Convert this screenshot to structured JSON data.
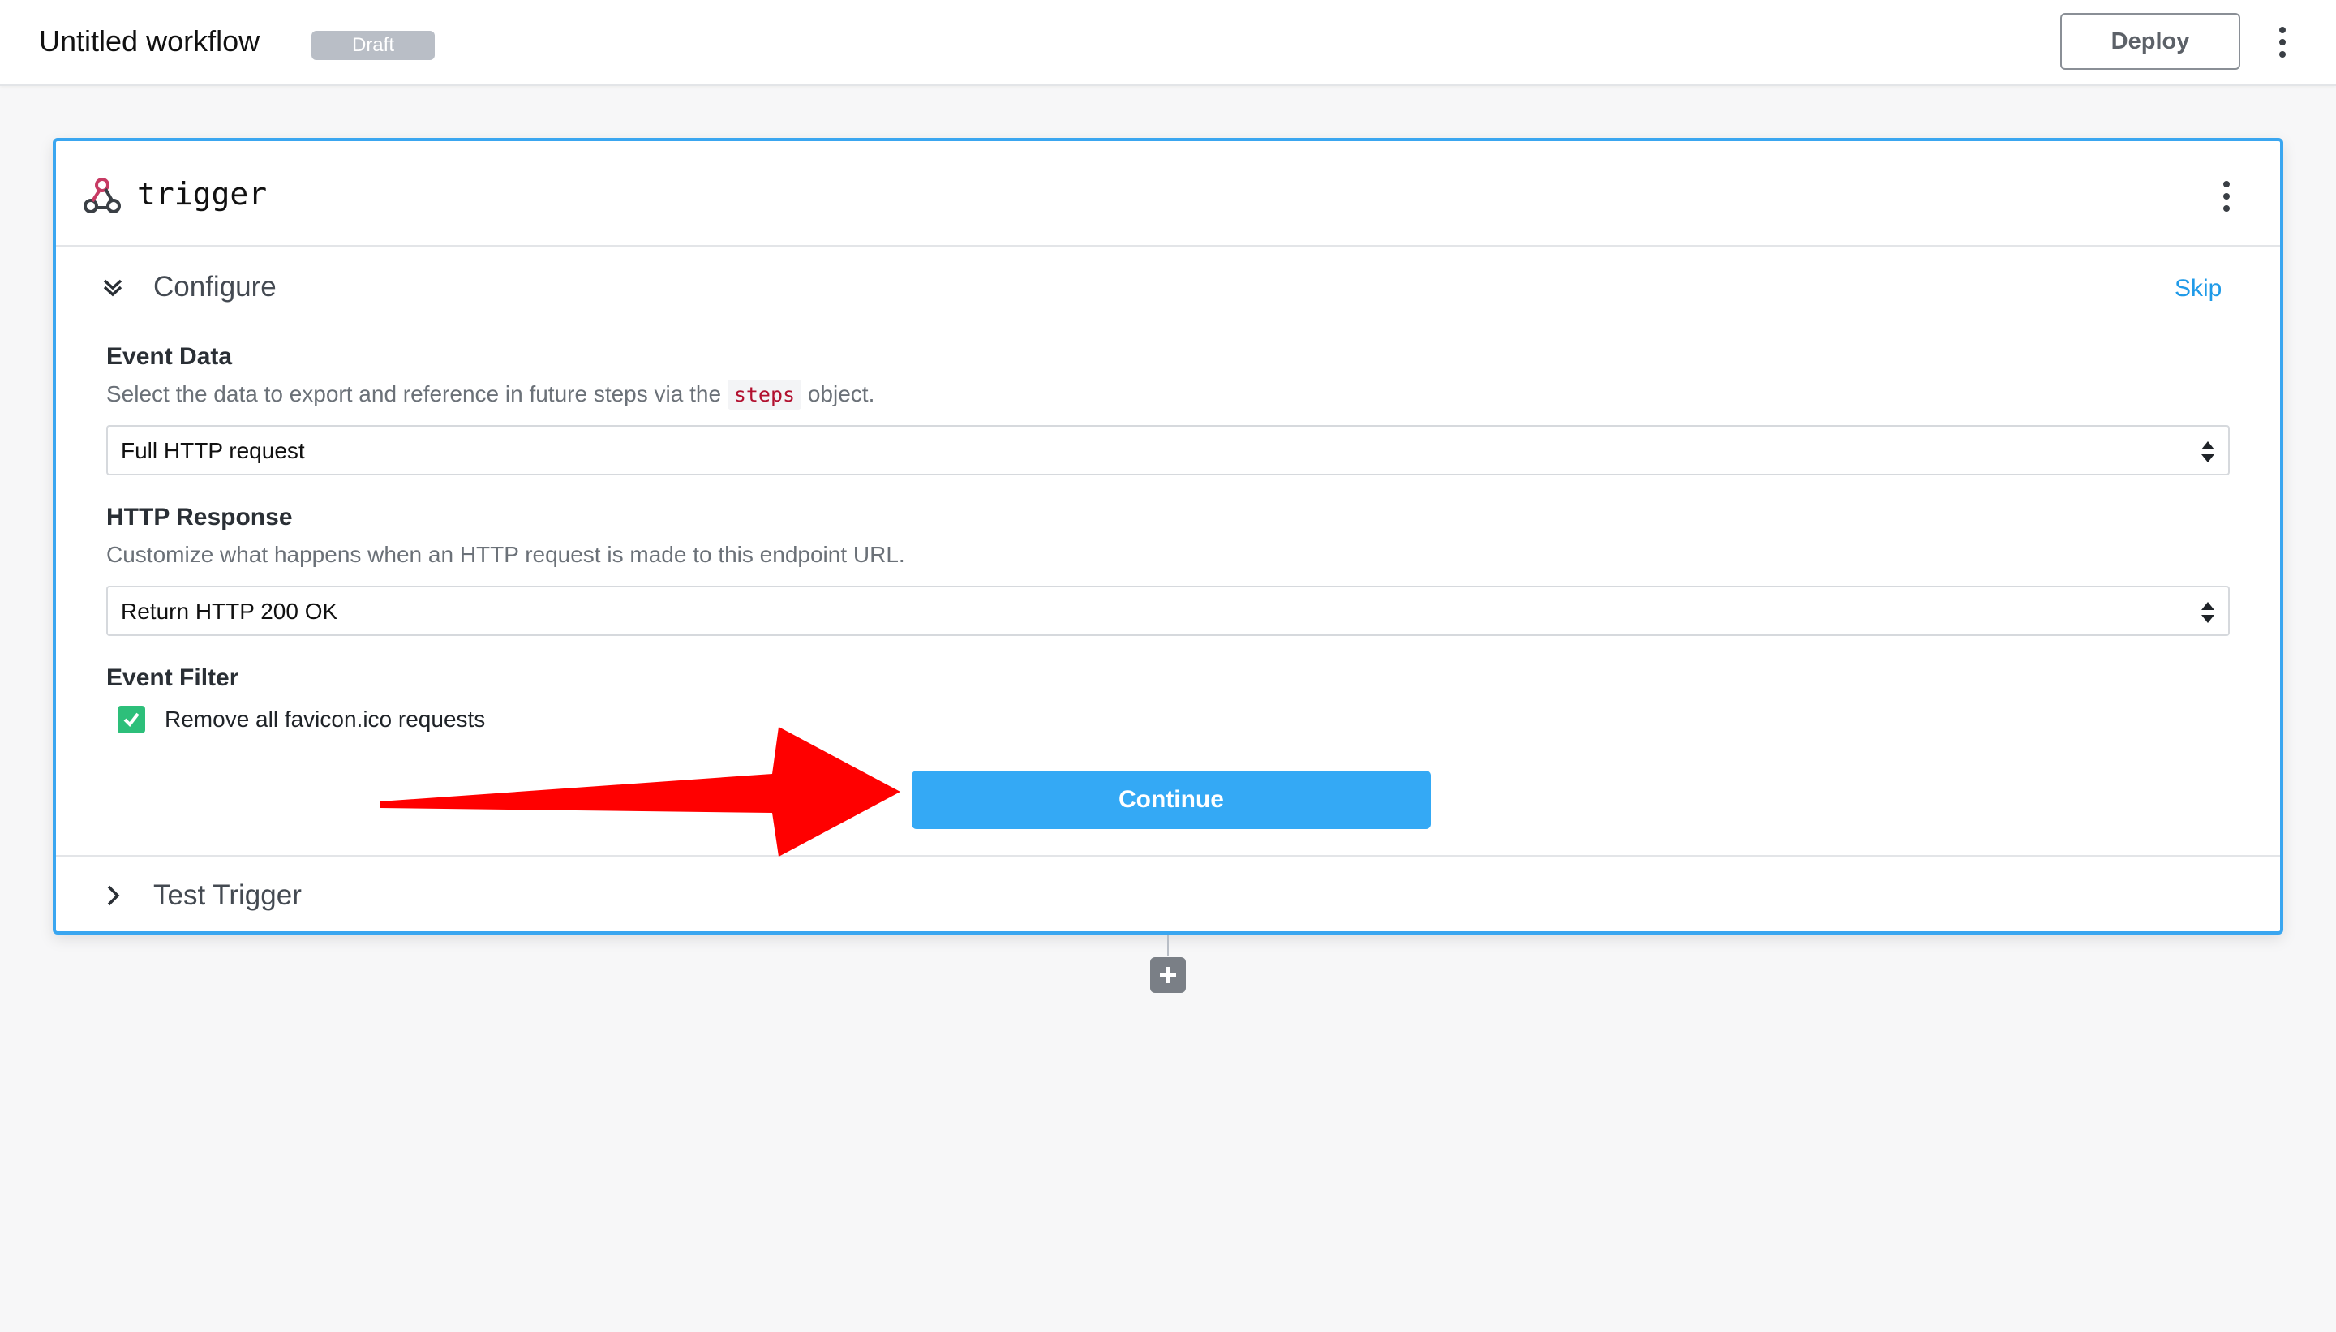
{
  "header": {
    "workflow_title": "Untitled workflow",
    "status_badge": "Draft",
    "deploy_label": "Deploy"
  },
  "trigger_card": {
    "name": "trigger",
    "configure_section": {
      "label": "Configure",
      "skip_label": "Skip",
      "event_data": {
        "title": "Event Data",
        "desc_before": "Select the data to export and reference in future steps via the ",
        "desc_code": "steps",
        "desc_after": " object.",
        "selected": "Full HTTP request"
      },
      "http_response": {
        "title": "HTTP Response",
        "desc": "Customize what happens when an HTTP request is made to this endpoint URL.",
        "selected": "Return HTTP 200 OK"
      },
      "event_filter": {
        "title": "Event Filter",
        "checkbox_label": "Remove all favicon.ico requests",
        "checked": true
      },
      "continue_label": "Continue"
    },
    "test_section": {
      "label": "Test Trigger"
    }
  },
  "colors": {
    "accent": "#34a9f5",
    "card_border": "#3aa6f0",
    "checkbox": "#2dbf7a",
    "annotation_arrow": "#ff0000"
  },
  "icons": [
    "webhook-icon",
    "kebab-menu-icon",
    "chevron-double-down-icon",
    "chevron-right-icon",
    "up-down-icon",
    "checkmark-icon",
    "plus-icon"
  ]
}
